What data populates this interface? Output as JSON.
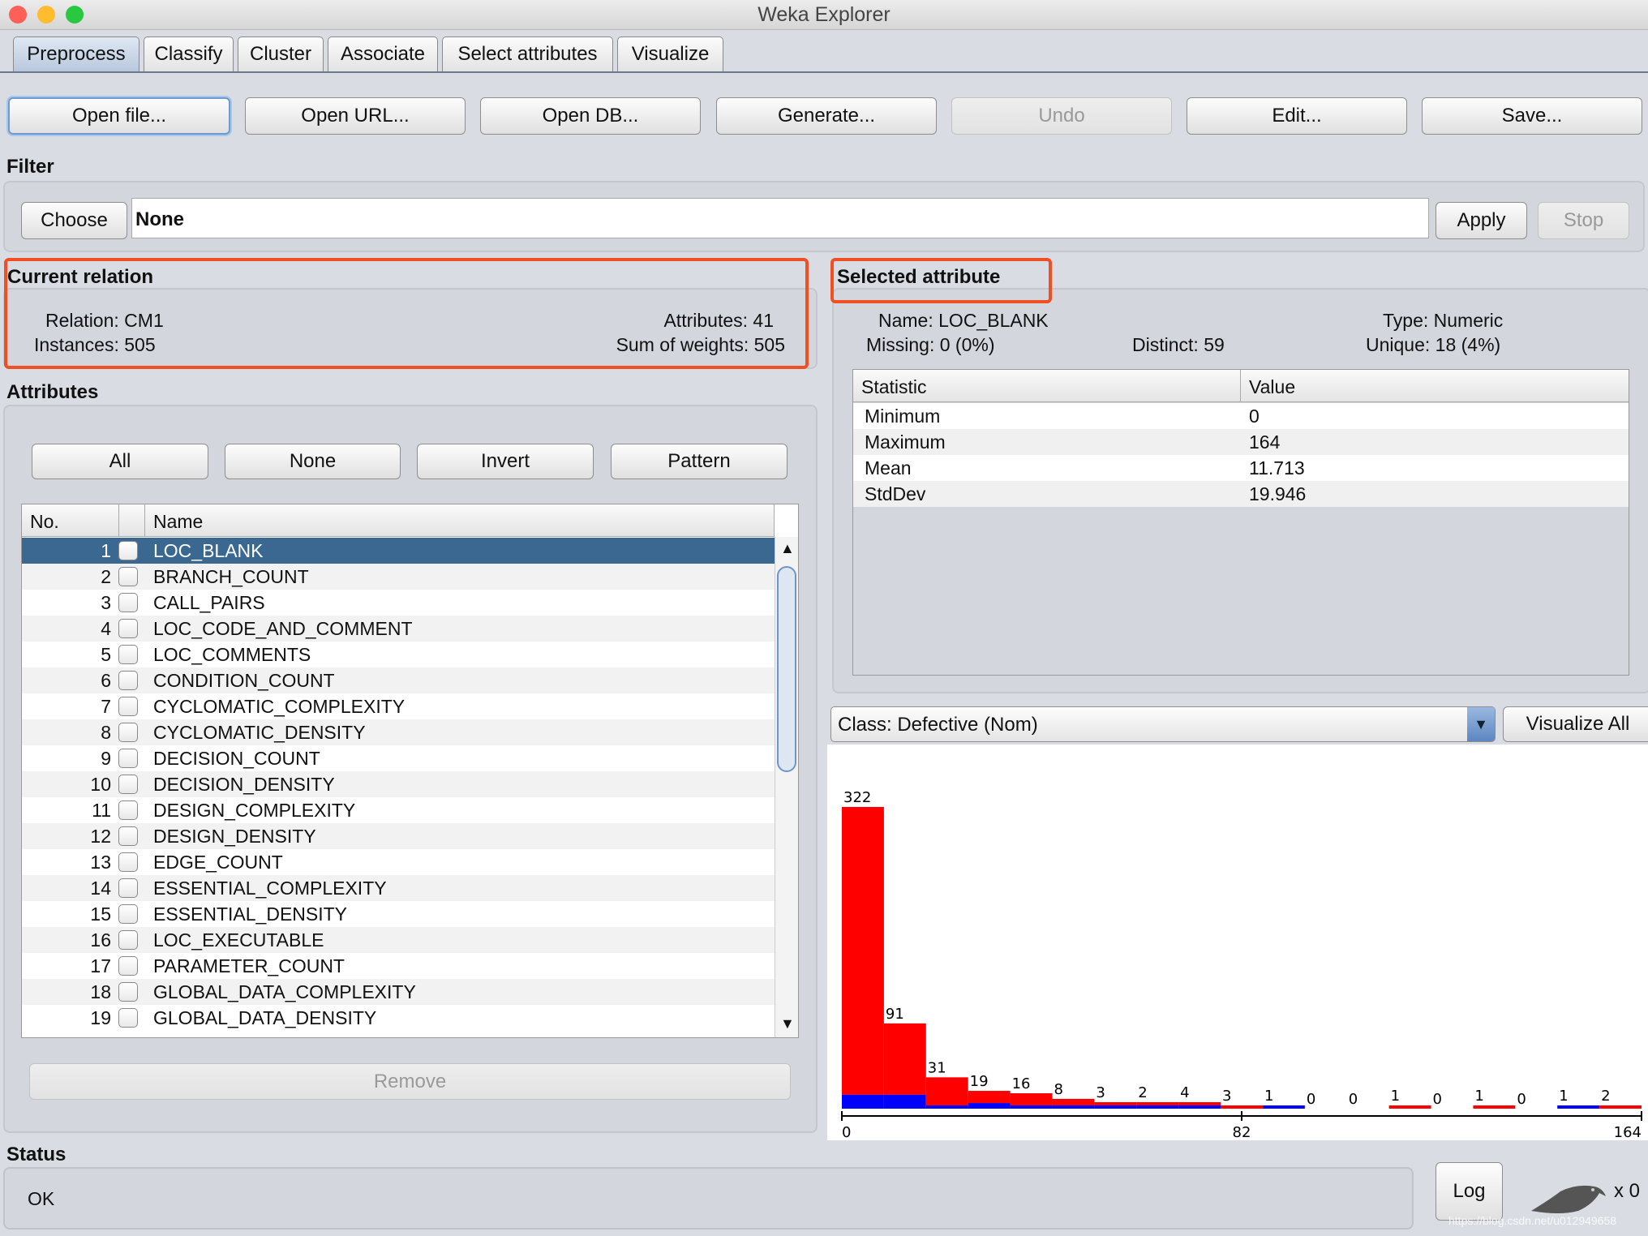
{
  "window": {
    "title": "Weka Explorer"
  },
  "tabs": [
    "Preprocess",
    "Classify",
    "Cluster",
    "Associate",
    "Select attributes",
    "Visualize"
  ],
  "toolbar": {
    "open_file": "Open file...",
    "open_url": "Open URL...",
    "open_db": "Open DB...",
    "generate": "Generate...",
    "undo": "Undo",
    "edit": "Edit...",
    "save": "Save..."
  },
  "filter": {
    "label": "Filter",
    "choose": "Choose",
    "value": "None",
    "apply": "Apply",
    "stop": "Stop"
  },
  "relation": {
    "label": "Current relation",
    "relation_label": "Relation:",
    "relation": "CM1",
    "instances_label": "Instances:",
    "instances": "505",
    "attributes_label": "Attributes:",
    "attributes": "41",
    "weights_label": "Sum of weights:",
    "weights": "505"
  },
  "selected": {
    "label": "Selected attribute",
    "name_label": "Name:",
    "name": "LOC_BLANK",
    "type_label": "Type:",
    "type": "Numeric",
    "missing_label": "Missing:",
    "missing": "0 (0%)",
    "distinct_label": "Distinct:",
    "distinct": "59",
    "unique_label": "Unique:",
    "unique": "18 (4%)",
    "table": {
      "headers": [
        "Statistic",
        "Value"
      ],
      "rows": [
        [
          "Minimum",
          "0"
        ],
        [
          "Maximum",
          "164"
        ],
        [
          "Mean",
          "11.713"
        ],
        [
          "StdDev",
          "19.946"
        ]
      ]
    }
  },
  "attributes": {
    "label": "Attributes",
    "all": "All",
    "none": "None",
    "invert": "Invert",
    "pattern": "Pattern",
    "col_no": "No.",
    "col_name": "Name",
    "remove": "Remove",
    "items": [
      [
        "1",
        "LOC_BLANK"
      ],
      [
        "2",
        "BRANCH_COUNT"
      ],
      [
        "3",
        "CALL_PAIRS"
      ],
      [
        "4",
        "LOC_CODE_AND_COMMENT"
      ],
      [
        "5",
        "LOC_COMMENTS"
      ],
      [
        "6",
        "CONDITION_COUNT"
      ],
      [
        "7",
        "CYCLOMATIC_COMPLEXITY"
      ],
      [
        "8",
        "CYCLOMATIC_DENSITY"
      ],
      [
        "9",
        "DECISION_COUNT"
      ],
      [
        "10",
        "DECISION_DENSITY"
      ],
      [
        "11",
        "DESIGN_COMPLEXITY"
      ],
      [
        "12",
        "DESIGN_DENSITY"
      ],
      [
        "13",
        "EDGE_COUNT"
      ],
      [
        "14",
        "ESSENTIAL_COMPLEXITY"
      ],
      [
        "15",
        "ESSENTIAL_DENSITY"
      ],
      [
        "16",
        "LOC_EXECUTABLE"
      ],
      [
        "17",
        "PARAMETER_COUNT"
      ],
      [
        "18",
        "GLOBAL_DATA_COMPLEXITY"
      ],
      [
        "19",
        "GLOBAL_DATA_DENSITY"
      ]
    ]
  },
  "class_select": {
    "value": "Class: Defective (Nom)",
    "visualize_all": "Visualize All"
  },
  "chart_data": {
    "type": "bar",
    "stacked": true,
    "xlim": [
      0,
      164
    ],
    "tick_labels": [
      "0",
      "82",
      "164"
    ],
    "colors": {
      "red": "#ff0000",
      "blue": "#0000ff"
    },
    "totals": [
      322,
      91,
      31,
      19,
      16,
      8,
      3,
      2,
      4,
      3,
      1,
      0,
      0,
      1,
      0,
      1,
      0,
      1,
      2
    ],
    "series": [
      {
        "color": "#0000ff",
        "values": [
          15,
          15,
          1,
          6,
          3,
          1,
          1,
          1,
          1,
          0,
          1,
          0,
          0,
          0,
          0,
          0,
          0,
          1,
          0
        ]
      },
      {
        "color": "#ff0000",
        "values": [
          307,
          76,
          30,
          13,
          13,
          7,
          2,
          1,
          3,
          3,
          0,
          0,
          0,
          1,
          0,
          1,
          0,
          0,
          2
        ]
      }
    ]
  },
  "status": {
    "label": "Status",
    "text": "OK",
    "log": "Log",
    "count": "x 0",
    "watermark": "https://blog.csdn.net/u012949658"
  }
}
